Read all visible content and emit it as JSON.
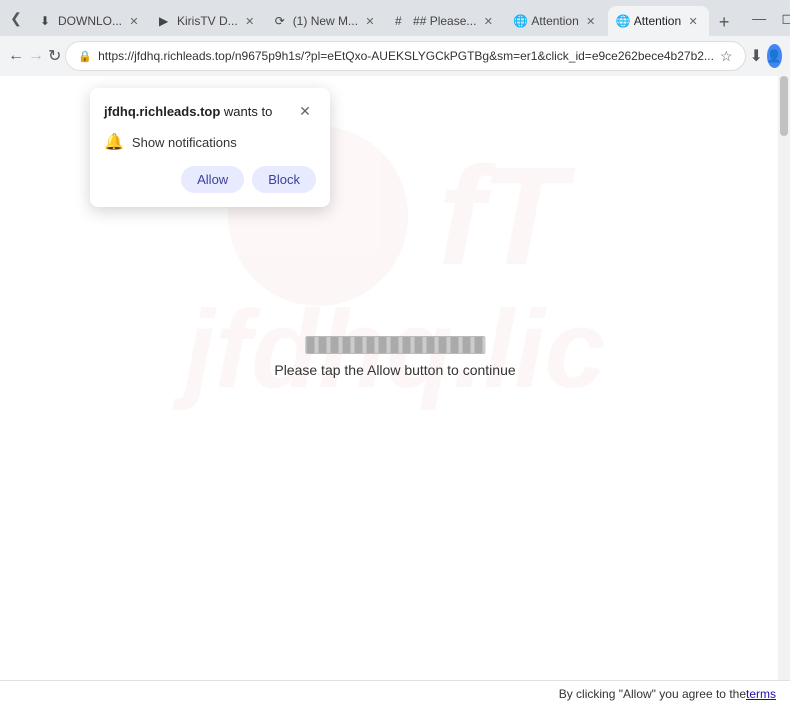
{
  "browser": {
    "tabs": [
      {
        "id": "tab1",
        "favicon": "↓",
        "title": "DOWNLO...",
        "active": false
      },
      {
        "id": "tab2",
        "favicon": "▶",
        "title": "KirisTV D...",
        "active": false
      },
      {
        "id": "tab3",
        "favicon": "✉",
        "title": "(1) New M...",
        "active": false
      },
      {
        "id": "tab4",
        "favicon": "##",
        "title": "## Please...",
        "active": false
      },
      {
        "id": "tab5",
        "favicon": "A",
        "title": "Attention",
        "active": false
      },
      {
        "id": "tab6",
        "favicon": "A",
        "title": "Attention",
        "active": true
      }
    ],
    "url": "https://jfdhq.richleads.top/n9675p9h1s/?pl=eEtQxo-AUEKSLYGCkPGTBg&sm=er1&click_id=e9ce262bece4b27b2...",
    "back_disabled": false,
    "forward_disabled": true
  },
  "notification_popup": {
    "site": "jfdhq.richleads.top",
    "wants_to": " wants to",
    "item_label": "Show notifications",
    "allow_label": "Allow",
    "block_label": "Block"
  },
  "page_content": {
    "progress_text": "Please tap the Allow button to continue"
  },
  "bottom_bar": {
    "text": "By clicking \"Allow\" you agree to the ",
    "link_text": "terms"
  }
}
